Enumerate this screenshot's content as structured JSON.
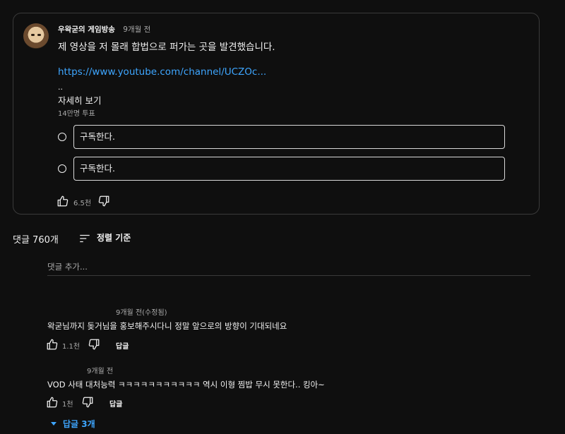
{
  "post": {
    "author": "우왁굳의 게임방송",
    "time": "9개월 전",
    "text": "제 영상을 저 몰래 합법으로 퍼가는 곳을 발견했습니다.",
    "link": "https://www.youtube.com/channel/UCZOc...",
    "ellipsis": "..",
    "read_more": "자세히 보기",
    "vote_count": "14만명 투표",
    "poll_options": [
      "구독한다.",
      "구독한다."
    ],
    "like_count": "6.5천"
  },
  "comments_section": {
    "count_label": "댓글 760개",
    "sort_label": "정렬 기준",
    "add_comment_placeholder": "댓글 추가..."
  },
  "comments": [
    {
      "meta": "9개월 전(수정됨)",
      "text": "왁굳님까지 돚거님을 홍보해주시다니 정말 앞으로의 방향이 기대되네요",
      "like_count": "1.1천",
      "reply_label": "답글"
    },
    {
      "meta": "9개월 전",
      "text": "VOD 사태 대처능력 ㅋㅋㅋㅋㅋㅋㅋㅋㅋㅋㅋ 역시 이형 찜밥 무시 못한다.. 킹아~",
      "like_count": "1천",
      "reply_label": "답글",
      "replies_label": "답글 3개"
    }
  ],
  "colors": {
    "background": "#0f0f0f",
    "text": "#f1f1f1",
    "secondary_text": "#aaaaaa",
    "link": "#3ea6ff",
    "border": "#3a3a3a"
  }
}
